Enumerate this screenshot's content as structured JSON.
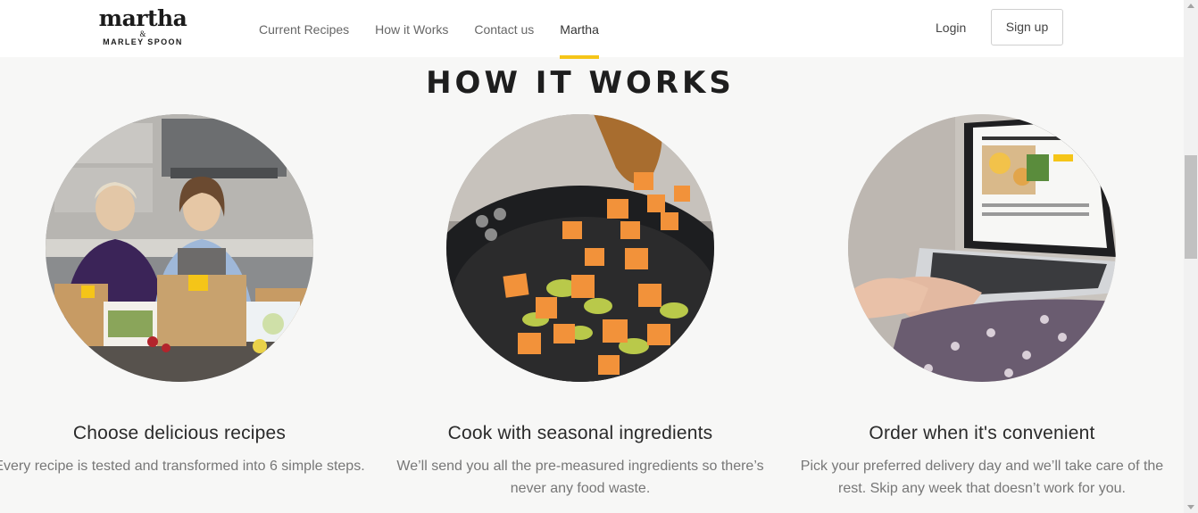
{
  "header": {
    "logo": {
      "main": "martha",
      "amp": "&",
      "sub": "MARLEY SPOON"
    },
    "nav": [
      {
        "label": "Current Recipes",
        "active": false
      },
      {
        "label": "How it Works",
        "active": false
      },
      {
        "label": "Contact us",
        "active": false
      },
      {
        "label": "Martha",
        "active": true
      }
    ],
    "login_label": "Login",
    "signup_label": "Sign up",
    "accent_color": "#f5c518"
  },
  "main": {
    "title": "HOW IT WORKS",
    "steps": [
      {
        "image_icon": "martha-kitchen-photo",
        "title": "Choose delicious recipes",
        "description": "Every recipe is tested and transformed into 6 simple steps."
      },
      {
        "image_icon": "skillet-cooking-photo",
        "title": "Cook with seasonal ingredients",
        "description": "We’ll send you all the pre-measured ingredients so there’s never any food waste."
      },
      {
        "image_icon": "laptop-ordering-photo",
        "title": "Order when it's convenient",
        "description": "Pick your preferred delivery day and we’ll take care of the rest. Skip any week that doesn’t work for you."
      }
    ]
  }
}
